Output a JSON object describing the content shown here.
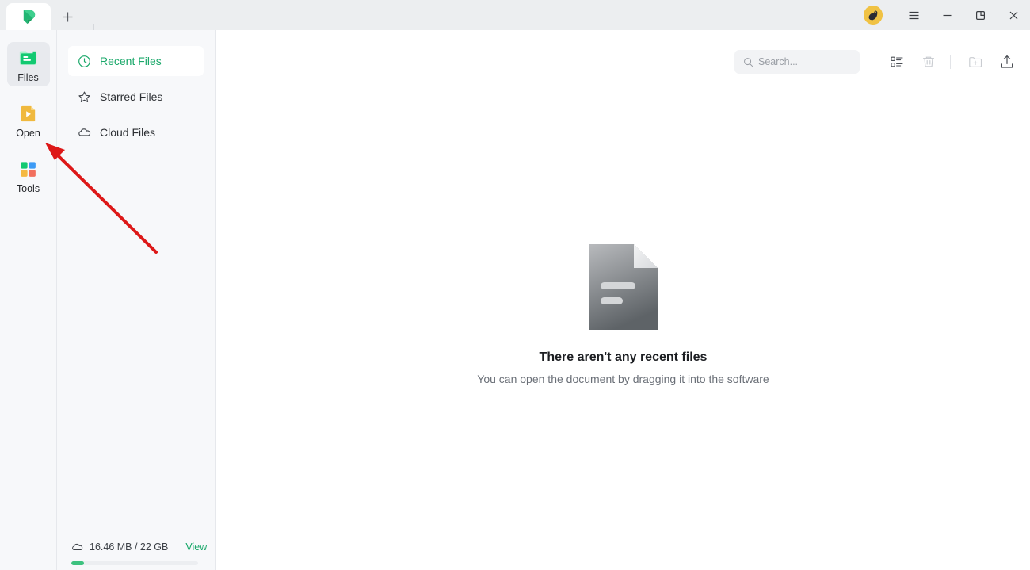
{
  "window": {
    "tab_logo_icon": "app-logo-p-icon",
    "new_tab_icon": "plus-icon",
    "avatar_icon": "user-avatar-bird-icon",
    "menu_icon": "hamburger-menu-icon",
    "minimize_icon": "minimize-icon",
    "maximize_icon": "maximize-restore-icon",
    "close_icon": "close-icon"
  },
  "rail": {
    "items": [
      {
        "label": "Files",
        "icon": "files-folder-icon",
        "active": true
      },
      {
        "label": "Open",
        "icon": "open-play-document-icon",
        "active": false
      },
      {
        "label": "Tools",
        "icon": "tools-grid-icon",
        "active": false
      }
    ]
  },
  "nav": {
    "items": [
      {
        "label": "Recent Files",
        "icon": "clock-icon",
        "active": true
      },
      {
        "label": "Starred Files",
        "icon": "star-icon",
        "active": false
      },
      {
        "label": "Cloud Files",
        "icon": "cloud-icon",
        "active": false
      }
    ],
    "storage": {
      "icon": "cloud-icon",
      "text": "16.46 MB / 22 GB",
      "view_label": "View",
      "used_percent": 10
    }
  },
  "toolbar": {
    "search": {
      "placeholder": "Search...",
      "value": "",
      "icon": "search-icon"
    },
    "buttons": [
      {
        "icon": "list-view-icon",
        "name": "list-view-button",
        "dim": false
      },
      {
        "icon": "trash-icon",
        "name": "delete-button",
        "dim": true
      },
      {
        "icon": "new-folder-icon",
        "name": "new-folder-button",
        "dim": true
      },
      {
        "icon": "upload-icon",
        "name": "upload-button",
        "dim": false
      }
    ]
  },
  "main": {
    "empty_state": {
      "icon": "document-placeholder-icon",
      "title": "There aren't any recent files",
      "subtitle": "You can open the document by dragging it into the software"
    }
  },
  "annotation": {
    "arrow_color": "#dd1818",
    "points_at": "Open"
  },
  "colors": {
    "accent_green": "#1aa86a",
    "rail_bg": "#f7f8fa",
    "titlebar_bg": "#eceef0",
    "annotation_red": "#dd1818"
  }
}
